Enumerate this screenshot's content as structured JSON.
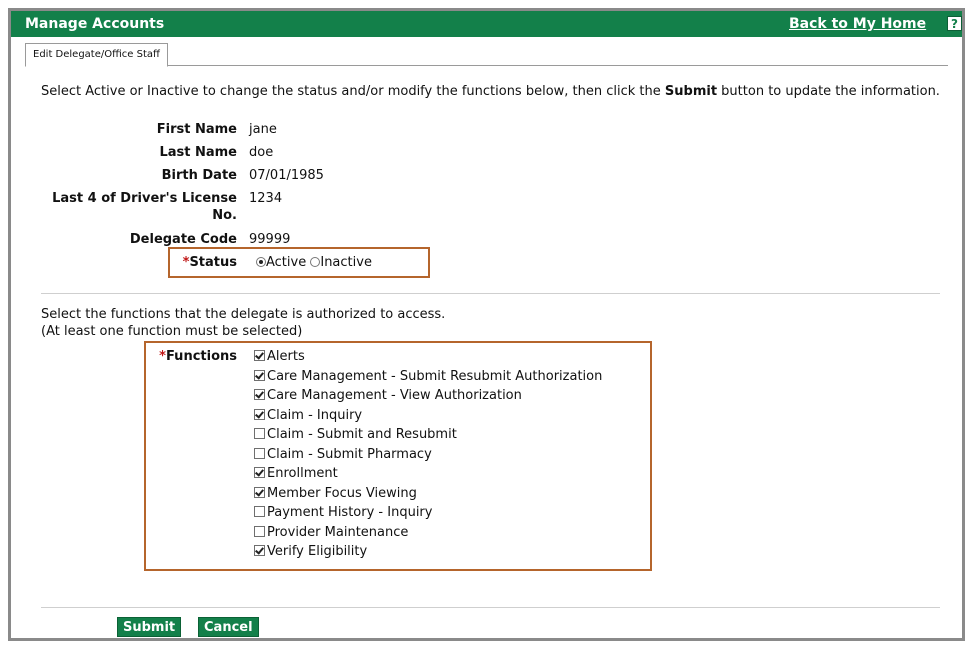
{
  "header": {
    "title": "Manage Accounts",
    "back_link": "Back to My Home",
    "help_label": "?"
  },
  "tab": {
    "label": "Edit Delegate/Office Staff"
  },
  "intro": {
    "text_before": "Select Active or Inactive to change the status and/or modify the functions below, then click the ",
    "text_bold": "Submit",
    "text_after": " button to update the information."
  },
  "fields": {
    "first_name": {
      "label": "First Name",
      "value": "jane"
    },
    "last_name": {
      "label": "Last Name",
      "value": "doe"
    },
    "birth_date": {
      "label": "Birth Date",
      "value": "07/01/1985"
    },
    "license": {
      "label_line1": "Last 4 of Driver's License",
      "label_line2": "No.",
      "value": "1234"
    },
    "delegate_code": {
      "label": "Delegate Code",
      "value": "99999"
    }
  },
  "status": {
    "required_mark": "*",
    "label": "Status",
    "options": [
      "Active",
      "Inactive"
    ],
    "selected": "Active"
  },
  "functions_intro": {
    "line1": "Select the functions that the delegate is authorized to access.",
    "line2": "(At least one function must be selected)"
  },
  "functions": {
    "required_mark": "*",
    "label": "Functions",
    "items": [
      {
        "label": "Alerts",
        "checked": true
      },
      {
        "label": "Care Management - Submit Resubmit Authorization",
        "checked": true
      },
      {
        "label": "Care Management - View Authorization",
        "checked": true
      },
      {
        "label": "Claim - Inquiry",
        "checked": true
      },
      {
        "label": "Claim - Submit and Resubmit",
        "checked": false
      },
      {
        "label": "Claim - Submit Pharmacy",
        "checked": false
      },
      {
        "label": "Enrollment",
        "checked": true
      },
      {
        "label": "Member Focus Viewing",
        "checked": true
      },
      {
        "label": "Payment History - Inquiry",
        "checked": false
      },
      {
        "label": "Provider Maintenance",
        "checked": false
      },
      {
        "label": "Verify Eligibility",
        "checked": true
      }
    ]
  },
  "buttons": {
    "submit": "Submit",
    "cancel": "Cancel"
  },
  "colors": {
    "brand_green": "#13804a",
    "highlight_border": "#b5652c",
    "required": "#c01717"
  }
}
